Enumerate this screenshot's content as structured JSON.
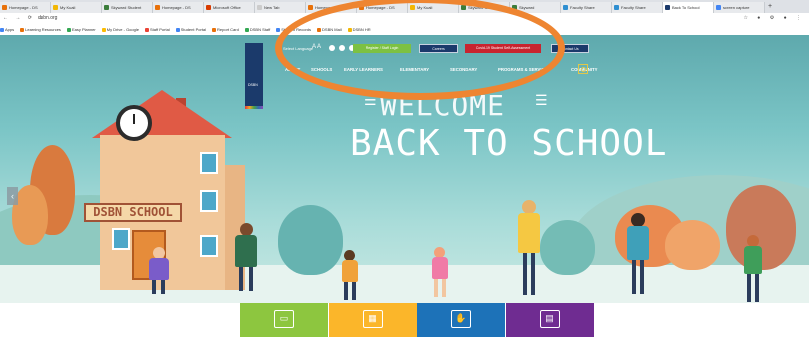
{
  "browser": {
    "tabs": [
      {
        "label": "Homepage - DS",
        "fav": "#e8710a"
      },
      {
        "label": "My Kuali",
        "fav": "#f2b705"
      },
      {
        "label": "Skyward Student",
        "fav": "#3b7d3b"
      },
      {
        "label": "Homepage - DS",
        "fav": "#e8710a"
      },
      {
        "label": "Microsoft Office",
        "fav": "#d83b01"
      },
      {
        "label": "New Tab",
        "fav": "#cccccc"
      },
      {
        "label": "Homepage - DS",
        "fav": "#e8710a"
      },
      {
        "label": "Homepage - DS",
        "fav": "#e8710a"
      },
      {
        "label": "My Kuali",
        "fav": "#f2b705"
      },
      {
        "label": "Skyward Student",
        "fav": "#3b7d3b"
      },
      {
        "label": "Skyward",
        "fav": "#3b7d3b"
      },
      {
        "label": "Faculty Share",
        "fav": "#2f8fd1"
      },
      {
        "label": "Faculty Share",
        "fav": "#2f8fd1"
      },
      {
        "label": "Back To School",
        "fav": "#1b3a6b",
        "active": true
      },
      {
        "label": "screen capture",
        "fav": "#4285f4"
      }
    ],
    "url": "dsbn.org",
    "bookmarks": [
      {
        "label": "Apps",
        "fav": "#4285f4"
      },
      {
        "label": "Learning Resources",
        "fav": "#e8710a"
      },
      {
        "label": "Easy Planner",
        "fav": "#34a853"
      },
      {
        "label": "My Drive - Google",
        "fav": "#fbbc04"
      },
      {
        "label": "Staff Portal",
        "fav": "#ea4335"
      },
      {
        "label": "Student Portal",
        "fav": "#4285f4"
      },
      {
        "label": "Report Card",
        "fav": "#e8710a"
      },
      {
        "label": "DSBN Staff",
        "fav": "#34a853"
      },
      {
        "label": "Student Records",
        "fav": "#4285f4"
      },
      {
        "label": "DSBN Mail",
        "fav": "#e8710a"
      },
      {
        "label": "DSBN HR",
        "fav": "#f2b705"
      }
    ]
  },
  "site": {
    "logo_text": "DSBN",
    "util": {
      "select_language": "Select Language",
      "font_size": "A A",
      "btn_green": "Register / Staff Login",
      "btn_blue": "Careers",
      "btn_red": "Covid-19 Student Self-Assessment",
      "btn_darkblue": "Contact Us"
    },
    "nav": [
      "ABOUT",
      "SCHOOLS",
      "EARLY LEARNERS",
      "ELEMENTARY",
      "SECONDARY",
      "PROGRAMS & SERVICES",
      "COMMUNITY"
    ],
    "hero": {
      "welcome": "WELCOME",
      "back_to_school": "BACK TO SCHOOL",
      "school_sign": "DSBN SCHOOL"
    },
    "tiles": [
      {
        "color": "#8dc63f",
        "icon": "laptop-icon"
      },
      {
        "color": "#fbb62a",
        "icon": "calendar-icon"
      },
      {
        "color": "#1d72b8",
        "icon": "hand-icon"
      },
      {
        "color": "#6f2c91",
        "icon": "book-icon"
      }
    ],
    "colors": {
      "annotation_circle": "#ee8531",
      "nav_highlight": "#e0c84a",
      "header_bg": "#1b3a6b"
    }
  }
}
